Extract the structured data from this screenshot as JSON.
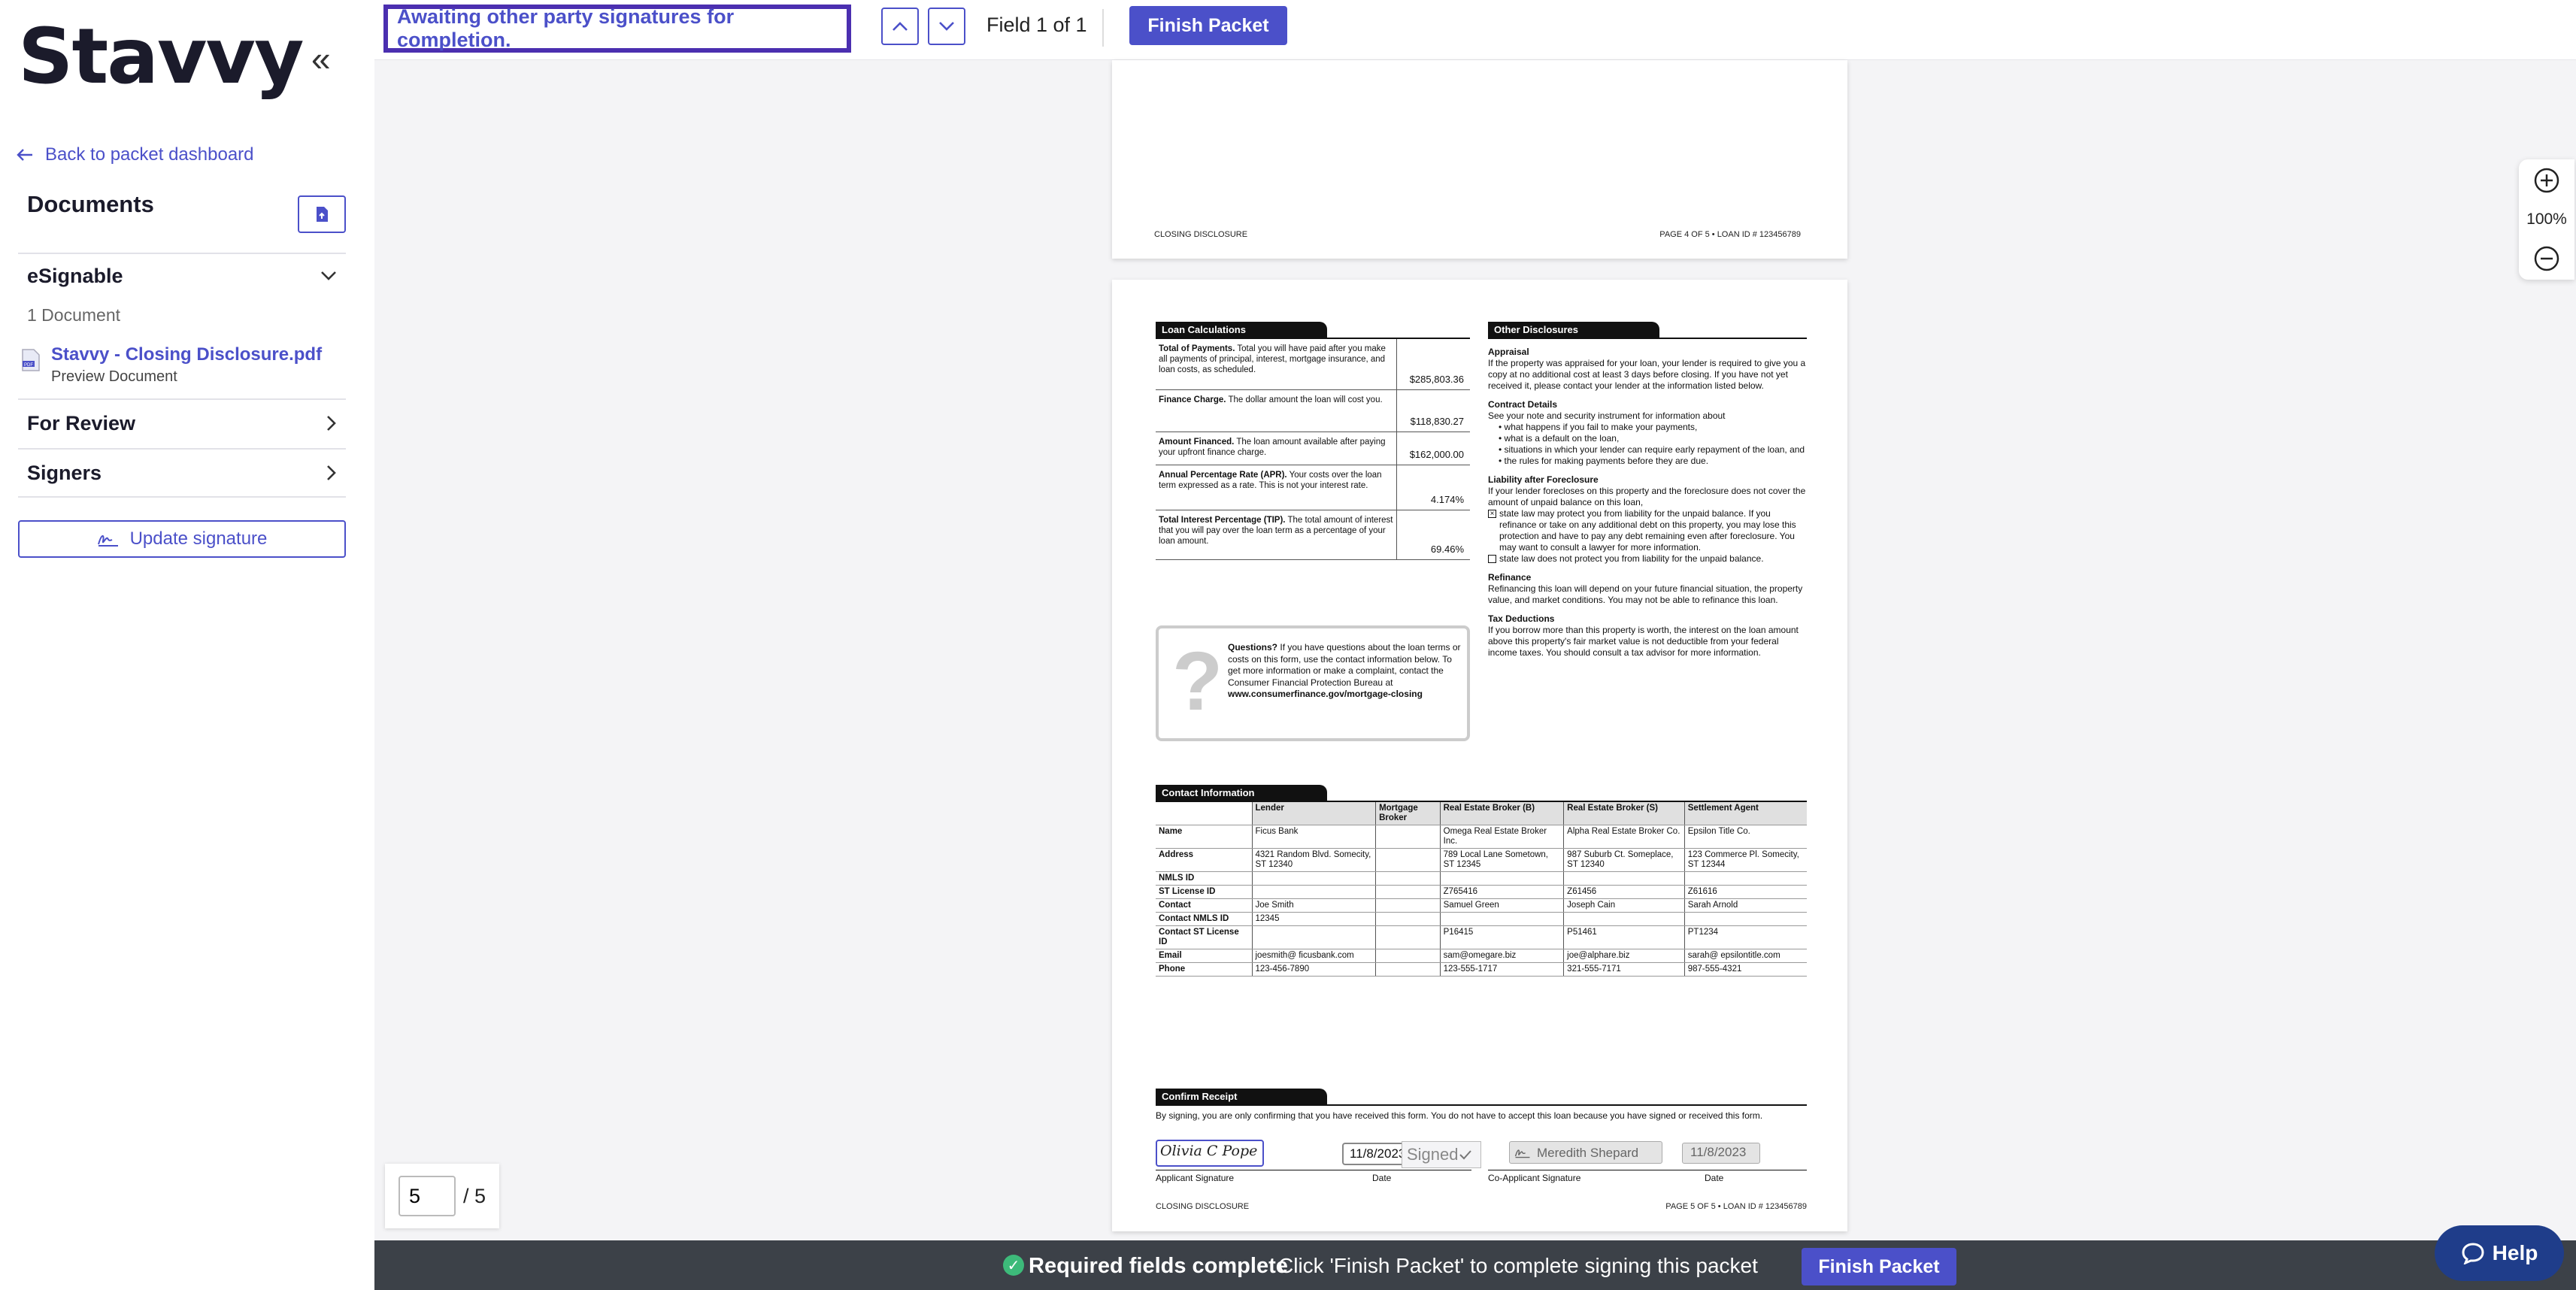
{
  "app": {
    "logo": "Stavvy",
    "collapse_glyph": "«"
  },
  "sidebar": {
    "back_link": "Back to packet dashboard",
    "documents_title": "Documents",
    "sections": [
      {
        "title": "eSignable",
        "expanded": true
      },
      {
        "title": "For Review",
        "expanded": false
      },
      {
        "title": "Signers",
        "expanded": false
      }
    ],
    "doc_count": "1 Document",
    "doc_name": "Stavvy - Closing Disclosure.pdf",
    "doc_sub": "Preview Document",
    "update_signature": "Update signature"
  },
  "topbar": {
    "status": "Awaiting other party signatures for completion.",
    "field_counter": "Field 1 of 1",
    "finish_label": "Finish Packet"
  },
  "page4_footer": {
    "left": "CLOSING DISCLOSURE",
    "right": "PAGE 4 OF 5 • LOAN ID # 123456789"
  },
  "page5": {
    "loan_calc_title": "Loan Calculations",
    "loan_calc": [
      {
        "label": "Total of Payments.",
        "desc": "Total you will have paid after you make all payments of principal, interest, mortgage insurance, and loan costs, as scheduled.",
        "value": "$285,803.36"
      },
      {
        "label": "Finance Charge.",
        "desc": "The dollar amount the loan will cost you.",
        "value": "$118,830.27"
      },
      {
        "label": "Amount Financed.",
        "desc": "The loan amount available after paying your upfront finance charge.",
        "value": "$162,000.00"
      },
      {
        "label": "Annual Percentage Rate (APR).",
        "desc": "Your costs over the loan term expressed as a rate. This is not your interest rate.",
        "value": "4.174%"
      },
      {
        "label": "Total Interest Percentage (TIP).",
        "desc": "The total amount of interest that you will pay over the loan term as a percentage of your loan amount.",
        "value": "69.46%"
      }
    ],
    "questions": {
      "bold": "Questions?",
      "text": "If you have questions about the loan terms or costs on this form, use the contact information below. To get more information or make a complaint, contact the Consumer Financial Protection Bureau at",
      "url": "www.consumerfinance.gov/mortgage-closing"
    },
    "other_title": "Other Disclosures",
    "appraisal_h": "Appraisal",
    "appraisal": "If the property was appraised for your loan, your lender is required to give you a copy at no additional cost at least 3 days before closing. If you have not yet received it, please contact your lender at the information listed below.",
    "contract_h": "Contract Details",
    "contract": "See your note and security instrument for information about",
    "contract_items": [
      "what happens if you fail to make your payments,",
      "what is a default on the loan,",
      "situations in which your lender can require early repayment of the loan, and",
      "the rules for making payments before they are due."
    ],
    "liability_h": "Liability after Foreclosure",
    "liability": "If your lender forecloses on this property and the foreclosure does not cover the amount of unpaid balance on this loan,",
    "liability_opt1": "state law may protect you from liability for the unpaid balance. If you refinance or take on any additional debt on this property, you may lose this protection and have to pay any debt remaining even after foreclosure. You may want to consult a lawyer for more information.",
    "liability_opt2": "state law does not protect you from liability for the unpaid balance.",
    "refinance_h": "Refinance",
    "refinance": "Refinancing this loan will depend on your future financial situation, the property value, and market conditions. You may not be able to refinance this loan.",
    "tax_h": "Tax Deductions",
    "tax": "If you borrow more than this property is worth, the interest on the loan amount above this property's fair market value is not deductible from your federal income taxes. You should consult a tax advisor for more information.",
    "contact_title": "Contact Information",
    "contact_cols": [
      "Lender",
      "Mortgage Broker",
      "Real Estate Broker (B)",
      "Real Estate Broker (S)",
      "Settlement Agent"
    ],
    "contact_rows": [
      {
        "label": "Name",
        "cells": [
          "Ficus Bank",
          "",
          "Omega Real Estate Broker Inc.",
          "Alpha Real Estate Broker Co.",
          "Epsilon Title Co."
        ]
      },
      {
        "label": "Address",
        "cells": [
          "4321 Random Blvd. Somecity, ST 12340",
          "",
          "789 Local Lane Sometown, ST 12345",
          "987 Suburb Ct. Someplace, ST 12340",
          "123 Commerce Pl. Somecity, ST 12344"
        ]
      },
      {
        "label": "NMLS ID",
        "cells": [
          "",
          "",
          "",
          "",
          ""
        ]
      },
      {
        "label": "ST License ID",
        "cells": [
          "",
          "",
          "Z765416",
          "Z61456",
          "Z61616"
        ]
      },
      {
        "label": "Contact",
        "cells": [
          "Joe Smith",
          "",
          "Samuel Green",
          "Joseph Cain",
          "Sarah Arnold"
        ]
      },
      {
        "label": "Contact NMLS ID",
        "cells": [
          "12345",
          "",
          "",
          "",
          ""
        ]
      },
      {
        "label": "Contact ST License ID",
        "cells": [
          "",
          "",
          "P16415",
          "P51461",
          "PT1234"
        ]
      },
      {
        "label": "Email",
        "cells": [
          "joesmith@ ficusbank.com",
          "",
          "sam@omegare.biz",
          "joe@alphare.biz",
          "sarah@ epsilontitle.com"
        ]
      },
      {
        "label": "Phone",
        "cells": [
          "123-456-7890",
          "",
          "123-555-1717",
          "321-555-7171",
          "987-555-4321"
        ]
      }
    ],
    "confirm_title": "Confirm Receipt",
    "confirm_text": "By signing, you are only confirming that you have received this form. You do not have to accept this loan because you have signed or received this form.",
    "signature": "Olivia C Pope",
    "date1": "11/8/2023",
    "co_signature": "Meredith Shepard",
    "date2": "11/8/2023",
    "lbl_app_sig": "Applicant Signature",
    "lbl_date": "Date",
    "lbl_coapp_sig": "Co-Applicant Signature",
    "footer_left": "CLOSING DISCLOSURE",
    "footer_right": "PAGE 5 OF 5 • LOAN ID # 123456789",
    "signed_tag": "Signed"
  },
  "zoom": {
    "level": "100%"
  },
  "pager": {
    "current": "5",
    "total": "/ 5"
  },
  "bottombar": {
    "status": "Required fields complete",
    "message": "Click 'Finish Packet' to complete signing this packet",
    "finish_label": "Finish Packet"
  },
  "help": {
    "label": "Help"
  },
  "colors": {
    "accent": "#4b50c9",
    "status_border": "#4b2fb0",
    "dark_bar": "#3c4148",
    "success": "#3dba7a",
    "help": "#1f3d8a"
  }
}
